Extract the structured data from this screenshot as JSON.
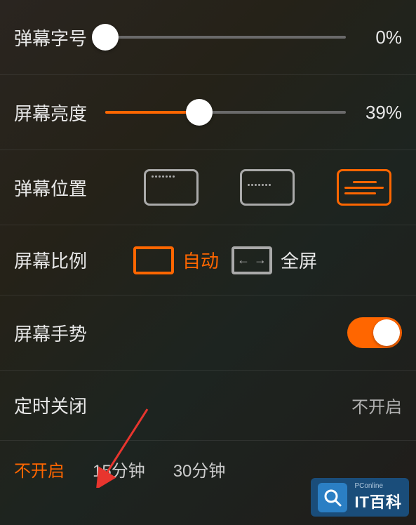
{
  "rows": {
    "danmuSize": {
      "label": "弹幕字号",
      "value": "0%",
      "percent": 0
    },
    "brightness": {
      "label": "屏幕亮度",
      "value": "39%",
      "percent": 39
    },
    "danmuPosition": {
      "label": "弹幕位置"
    },
    "aspectRatio": {
      "label": "屏幕比例",
      "auto": "自动",
      "fullscreen": "全屏"
    },
    "gesture": {
      "label": "屏幕手势",
      "on": true
    },
    "timer": {
      "label": "定时关闭",
      "value": "不开启"
    }
  },
  "timerOptions": [
    "不开启",
    "15分钟",
    "30分钟"
  ],
  "watermark": {
    "small": "PConline",
    "big": "IT百科"
  }
}
